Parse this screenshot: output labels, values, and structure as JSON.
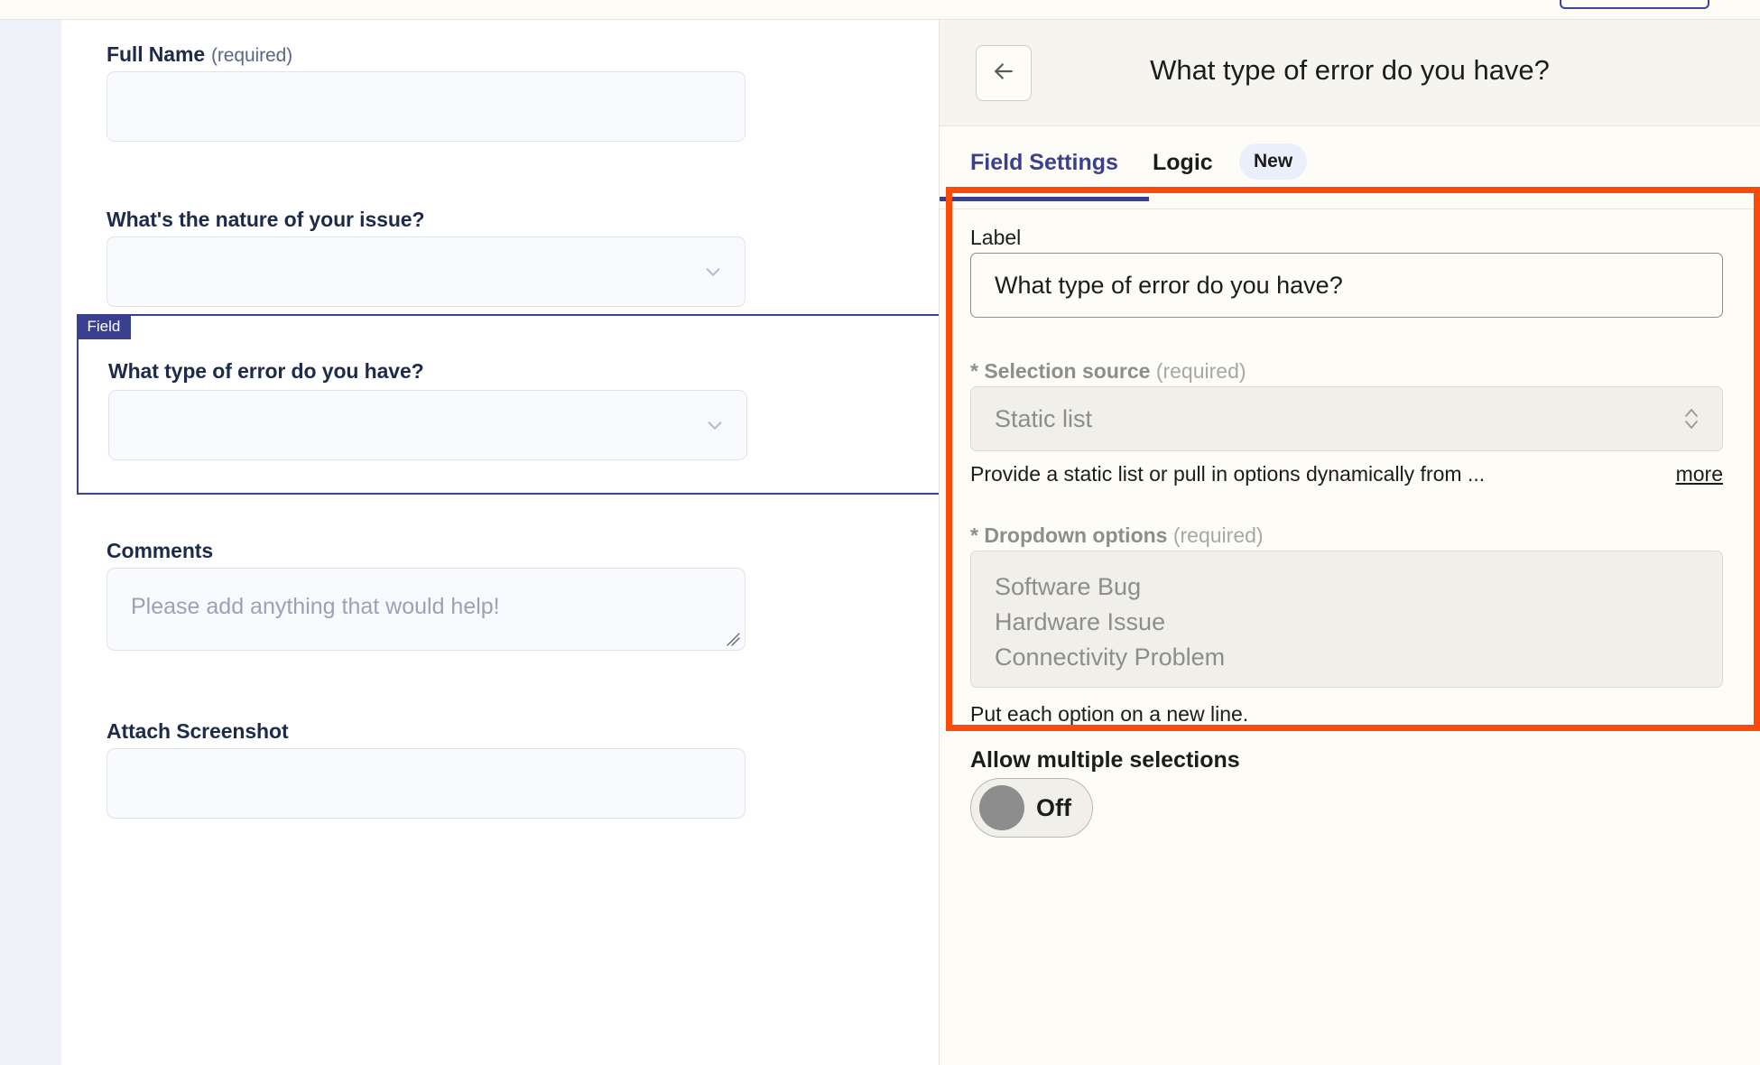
{
  "top_bar": {
    "title_fragment": "",
    "action_button_label": ""
  },
  "form": {
    "fields": [
      {
        "label": "Full Name",
        "required_note": "(required)",
        "type": "text",
        "value": "",
        "placeholder": ""
      },
      {
        "label": "What's the nature of your issue?",
        "required_note": "",
        "type": "dropdown",
        "value": "",
        "placeholder": ""
      },
      {
        "label": "What type of error do you have?",
        "required_note": "",
        "type": "dropdown",
        "value": "",
        "placeholder": "",
        "selected": true,
        "badge": "Field"
      },
      {
        "label": "Comments",
        "required_note": "",
        "type": "textarea",
        "value": "",
        "placeholder": "Please add anything that would help!"
      },
      {
        "label": "Attach Screenshot",
        "required_note": "",
        "type": "file",
        "value": "",
        "placeholder": ""
      }
    ]
  },
  "settings_panel": {
    "header": {
      "back_icon": "arrow-left-icon",
      "title": "What type of error do you have?"
    },
    "tabs": [
      {
        "label": "Field Settings",
        "active": true,
        "badge": ""
      },
      {
        "label": "Logic",
        "active": false,
        "badge": "New"
      }
    ],
    "label_field": {
      "label": "Label",
      "value": "What type of error do you have?"
    },
    "selection_source": {
      "label": "* Selection source",
      "required_note": "(required)",
      "value": "Static list",
      "help_text": "Provide a static list or pull in options dynamically from ...",
      "more_link": "more"
    },
    "dropdown_options": {
      "label": "* Dropdown options",
      "required_note": "(required)",
      "value": "Software Bug\nHardware Issue\nConnectivity Problem",
      "options": [
        "Software Bug",
        "Hardware Issue",
        "Connectivity Problem"
      ],
      "help_text": "Put each option on a new line."
    },
    "allow_multiple": {
      "label": "Allow multiple selections",
      "state": "Off"
    }
  },
  "annotation": {
    "color": "#fa4b0b"
  },
  "colors": {
    "accent_indigo": "#3b3f8f",
    "panel_bg": "#fdfcf7",
    "form_input_bg": "#f8fafd",
    "annotation_orange": "#fa4b0b"
  }
}
